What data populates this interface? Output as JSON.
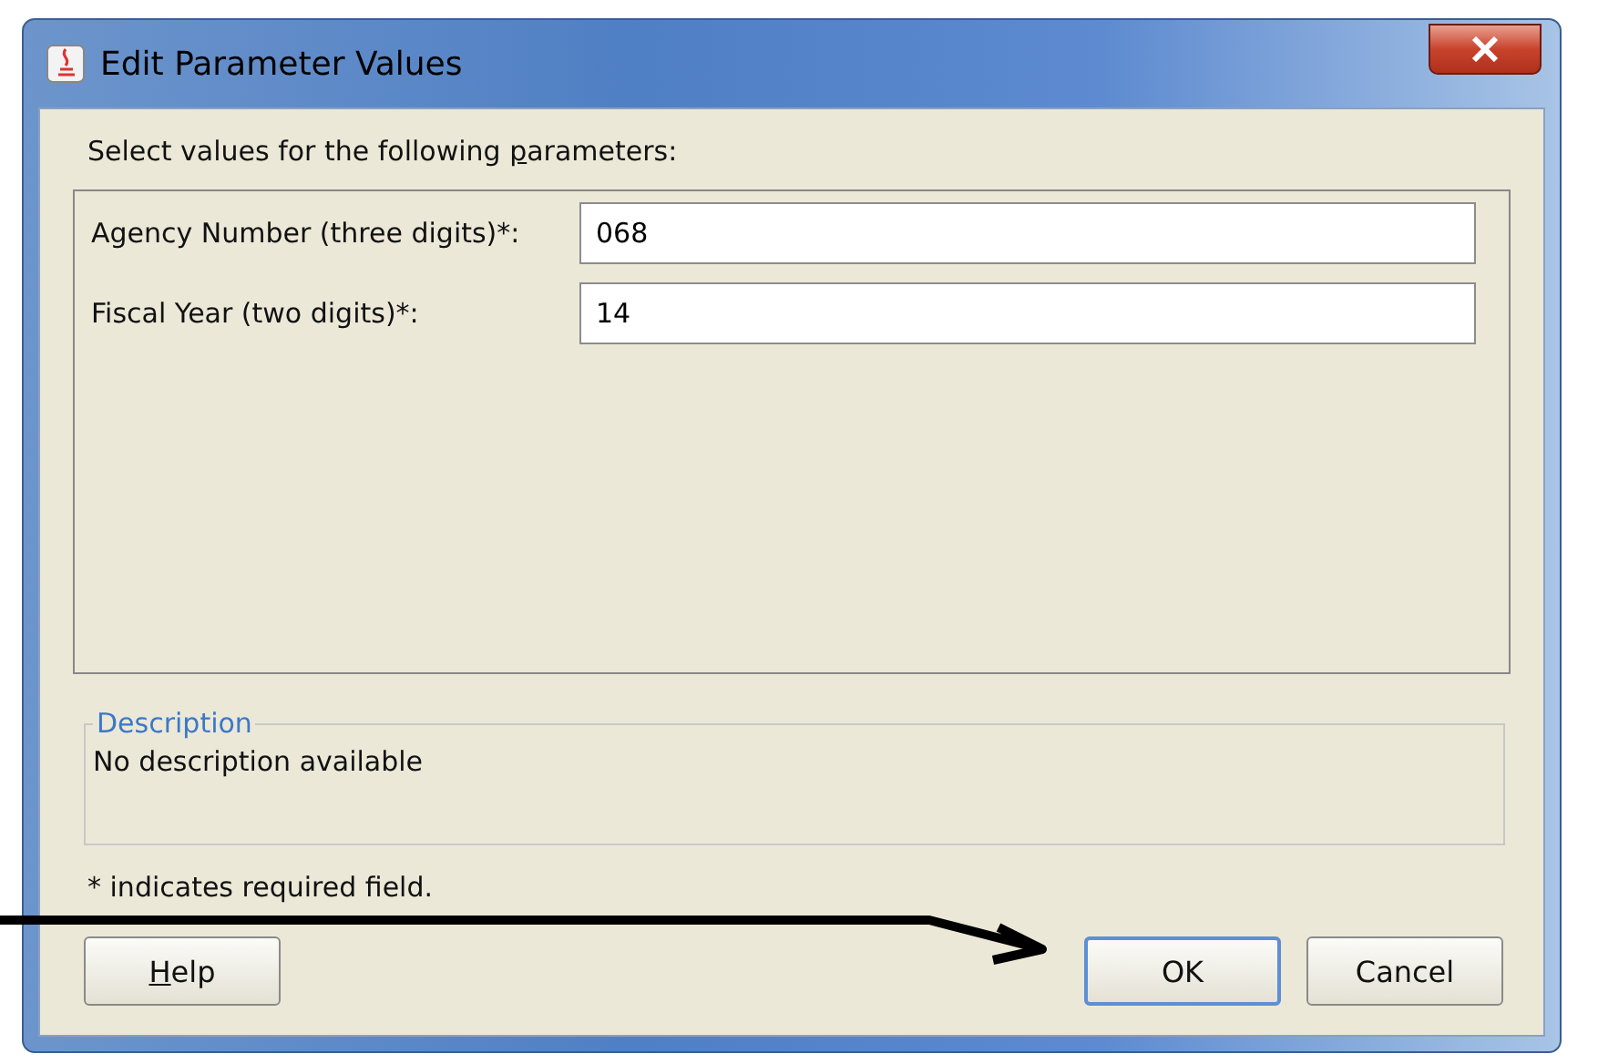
{
  "window": {
    "title": "Edit Parameter Values"
  },
  "prompt": {
    "before": "Select values for the following ",
    "key": "p",
    "after": "arameters:"
  },
  "parameters": [
    {
      "label": "Agency Number (three digits)*:",
      "value": "068"
    },
    {
      "label": "Fiscal Year (two digits)*:",
      "value": "14"
    }
  ],
  "description": {
    "title": "Description",
    "text": "No description available"
  },
  "note": "* indicates required field.",
  "buttons": [
    {
      "kind": "mnemonic",
      "key": "H",
      "rest": "elp",
      "selected": false
    },
    {
      "kind": "plain",
      "label": "OK",
      "selected": true
    },
    {
      "kind": "plain",
      "label": "Cancel",
      "selected": false
    }
  ]
}
